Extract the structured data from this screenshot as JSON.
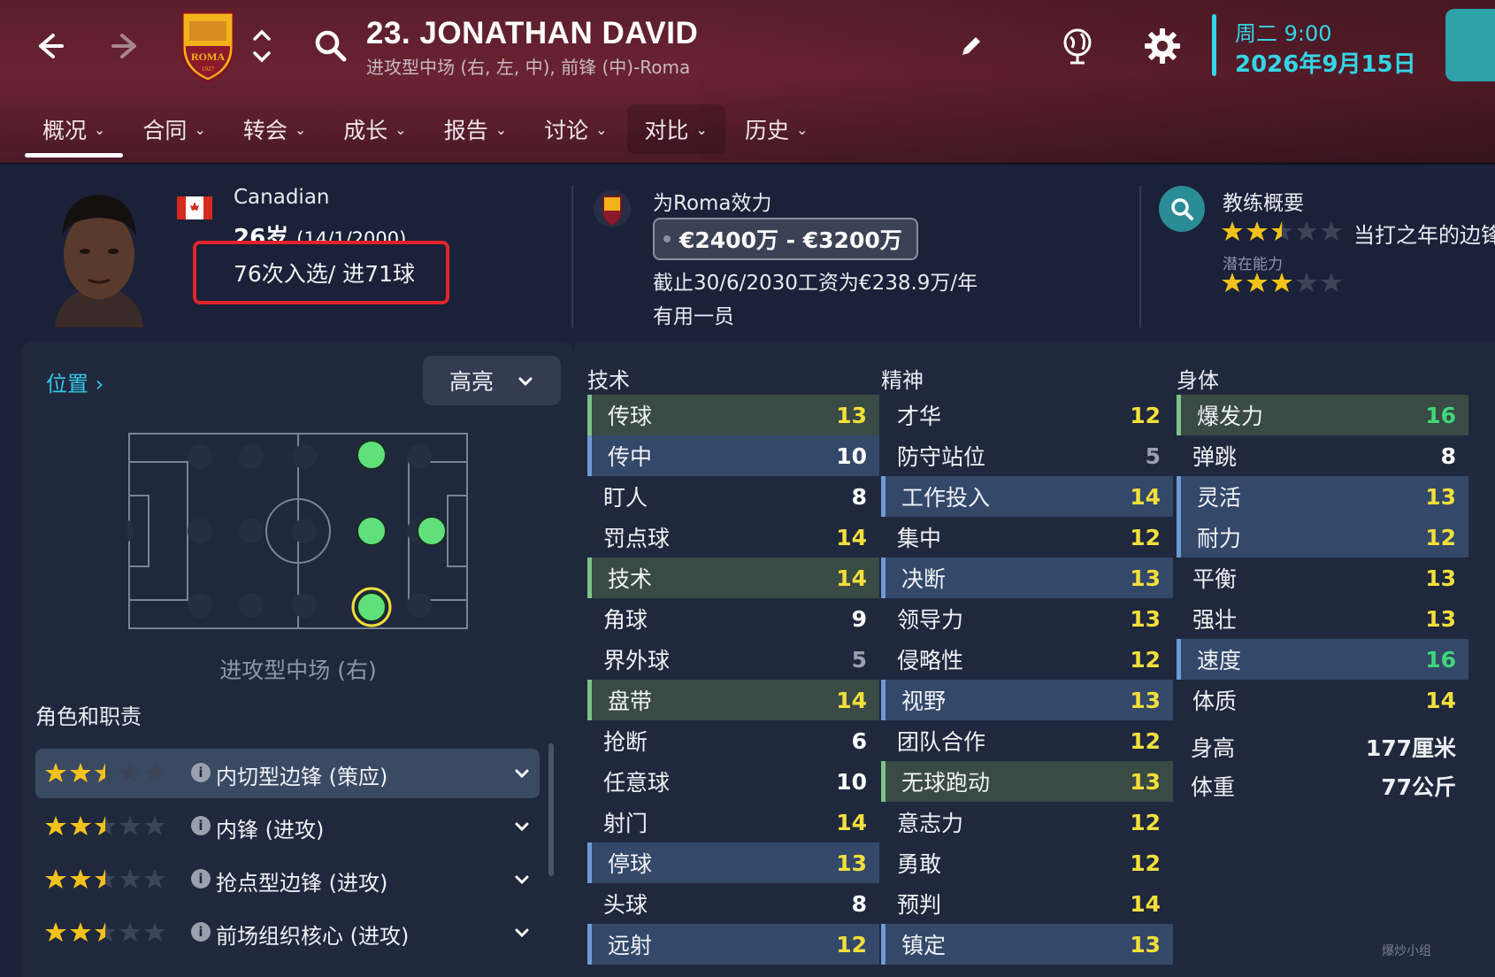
{
  "header": {
    "player_name": "23. JONATHAN DAVID",
    "positions": "进攻型中场 (右, 左, 中), 前锋 (中)-Roma",
    "day_time": "周二 9:00",
    "date": "2026年9月15日",
    "club_badge_text": "ROMA",
    "club_badge_year": "1927"
  },
  "tabs": [
    {
      "label": "概况"
    },
    {
      "label": "合同"
    },
    {
      "label": "转会"
    },
    {
      "label": "成长"
    },
    {
      "label": "报告"
    },
    {
      "label": "讨论"
    },
    {
      "label": "对比"
    },
    {
      "label": "历史"
    }
  ],
  "profile": {
    "nationality": "Canadian",
    "age": "26岁",
    "dob": "(14/1/2000)",
    "caps": "76次入选/ 进71球",
    "plays_for": "为Roma效力",
    "value_range": "€2400万 - €3200万",
    "contract": "截止30/6/2030工资为€238.9万/年",
    "squad_status": "有用一员"
  },
  "coach": {
    "title": "教练概要",
    "ability_stars": 2.5,
    "quote": "当打之年的边锋",
    "potential_label": "潜在能力",
    "potential_stars": 3
  },
  "positions_panel": {
    "link_label": "位置",
    "highlight_label": "高亮",
    "position_name": "进攻型中场 (右)",
    "roles_title": "角色和职责",
    "roles": [
      {
        "label": "内切型边锋 (策应)",
        "stars": 2.5
      },
      {
        "label": "内锋 (进攻)",
        "stars": 2.5
      },
      {
        "label": "抢点型边锋 (进攻)",
        "stars": 2.5
      },
      {
        "label": "前场组织核心 (进攻)",
        "stars": 2.5
      }
    ]
  },
  "attributes": {
    "technical_title": "技术",
    "mental_title": "精神",
    "physical_title": "身体",
    "technical": [
      {
        "name": "传球",
        "value": "13",
        "hl": "green"
      },
      {
        "name": "传中",
        "value": "10",
        "hl": "blue"
      },
      {
        "name": "盯人",
        "value": "8",
        "hl": ""
      },
      {
        "name": "罚点球",
        "value": "14",
        "hl": ""
      },
      {
        "name": "技术",
        "value": "14",
        "hl": "green"
      },
      {
        "name": "角球",
        "value": "9",
        "hl": ""
      },
      {
        "name": "界外球",
        "value": "5",
        "hl": ""
      },
      {
        "name": "盘带",
        "value": "14",
        "hl": "green"
      },
      {
        "name": "抢断",
        "value": "6",
        "hl": ""
      },
      {
        "name": "任意球",
        "value": "10",
        "hl": ""
      },
      {
        "name": "射门",
        "value": "14",
        "hl": ""
      },
      {
        "name": "停球",
        "value": "13",
        "hl": "blue"
      },
      {
        "name": "头球",
        "value": "8",
        "hl": ""
      },
      {
        "name": "远射",
        "value": "12",
        "hl": "blue"
      }
    ],
    "mental": [
      {
        "name": "才华",
        "value": "12",
        "hl": ""
      },
      {
        "name": "防守站位",
        "value": "5",
        "hl": ""
      },
      {
        "name": "工作投入",
        "value": "14",
        "hl": "blue"
      },
      {
        "name": "集中",
        "value": "12",
        "hl": ""
      },
      {
        "name": "决断",
        "value": "13",
        "hl": "blue"
      },
      {
        "name": "领导力",
        "value": "13",
        "hl": ""
      },
      {
        "name": "侵略性",
        "value": "12",
        "hl": ""
      },
      {
        "name": "视野",
        "value": "13",
        "hl": "blue"
      },
      {
        "name": "团队合作",
        "value": "12",
        "hl": ""
      },
      {
        "name": "无球跑动",
        "value": "13",
        "hl": "green"
      },
      {
        "name": "意志力",
        "value": "12",
        "hl": ""
      },
      {
        "name": "勇敢",
        "value": "12",
        "hl": ""
      },
      {
        "name": "预判",
        "value": "14",
        "hl": ""
      },
      {
        "name": "镇定",
        "value": "13",
        "hl": "blue"
      }
    ],
    "physical": [
      {
        "name": "爆发力",
        "value": "16",
        "hl": "green"
      },
      {
        "name": "弹跳",
        "value": "8",
        "hl": ""
      },
      {
        "name": "灵活",
        "value": "13",
        "hl": "blue"
      },
      {
        "name": "耐力",
        "value": "12",
        "hl": "blue"
      },
      {
        "name": "平衡",
        "value": "13",
        "hl": ""
      },
      {
        "name": "强壮",
        "value": "13",
        "hl": ""
      },
      {
        "name": "速度",
        "value": "16",
        "hl": "blue"
      },
      {
        "name": "体质",
        "value": "14",
        "hl": ""
      }
    ],
    "height_label": "身高",
    "height_value": "177厘米",
    "weight_label": "体重",
    "weight_value": "77公斤"
  },
  "watermark": "爆炒小组",
  "colors": {
    "accent_cyan": "#33d6e6",
    "value_white": "#ffffff",
    "value_yellow": "#f2df3a",
    "value_grey": "#9aa0ae",
    "value_green": "#3fd67a",
    "caps_box_red": "#e0262b"
  }
}
